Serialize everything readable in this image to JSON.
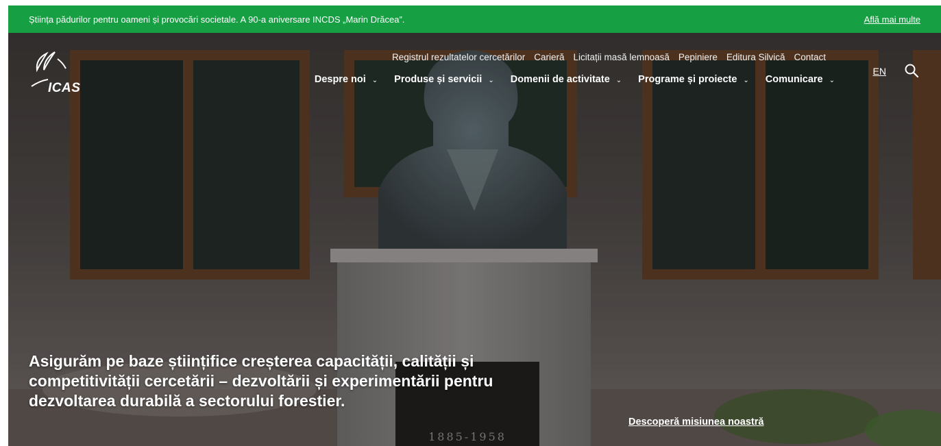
{
  "announcement": {
    "text": "Știința pădurilor pentru oameni și provocări societale. A 90-a aniversare INCDS „Marin Drăcea”.",
    "link_label": "Află mai multe"
  },
  "brand": {
    "logo_text": "ICAS"
  },
  "util_nav": [
    "Registrul rezultatelor cercetărilor",
    "Carieră",
    "Licitații masă lemnoasă",
    "Pepiniere",
    "Editura Silvică",
    "Contact"
  ],
  "main_nav": [
    "Despre noi",
    "Produse și servicii",
    "Domenii de activitate",
    "Programe și proiecte",
    "Comunicare"
  ],
  "language": "EN",
  "hero": {
    "headline": "Asigurăm pe baze științifice creșterea capacității, calității și competitivității cercetării – dezvoltării și experimentării pentru dezvoltarea durabilă a sectorului forestier.",
    "cta": "Descoperă misiunea noastră",
    "plaque_years": "1885-1958"
  },
  "colors": {
    "announcement_bg": "#17a043",
    "text": "#ffffff"
  },
  "icons": {
    "search": "search-icon",
    "chevron": "chevron-down-icon",
    "logo": "icas-logo-icon"
  }
}
